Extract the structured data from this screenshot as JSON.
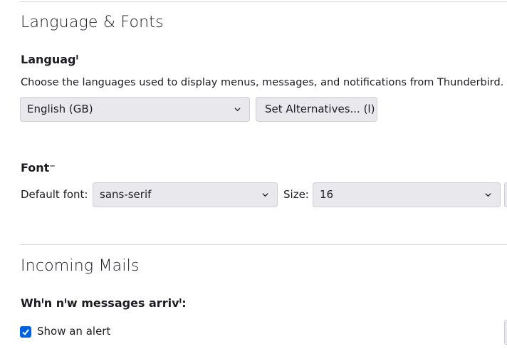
{
  "language_fonts": {
    "title": "Language & Fonts",
    "language": {
      "heading": "Languagᴵ",
      "description": "Choose the languages used to display menus, messages, and notifications from Thunderbird.",
      "selected": "English (GB)",
      "alternatives_button": "Set Alternatives... (l)"
    },
    "fonts": {
      "heading": "Font⁻",
      "default_font_label": "Default font:",
      "default_font_value": "sans-serif",
      "size_label": "Size:",
      "size_value": "16"
    }
  },
  "incoming": {
    "title": "Incoming Mails",
    "heading": "Whᴵn nᴵw messages arrivᴵ:",
    "show_alert_label": "Show an alert",
    "show_alert_checked": true
  },
  "colors": {
    "accent": "#0061e0",
    "control_bg": "#e9e9ed",
    "divider": "#d7d7db"
  }
}
